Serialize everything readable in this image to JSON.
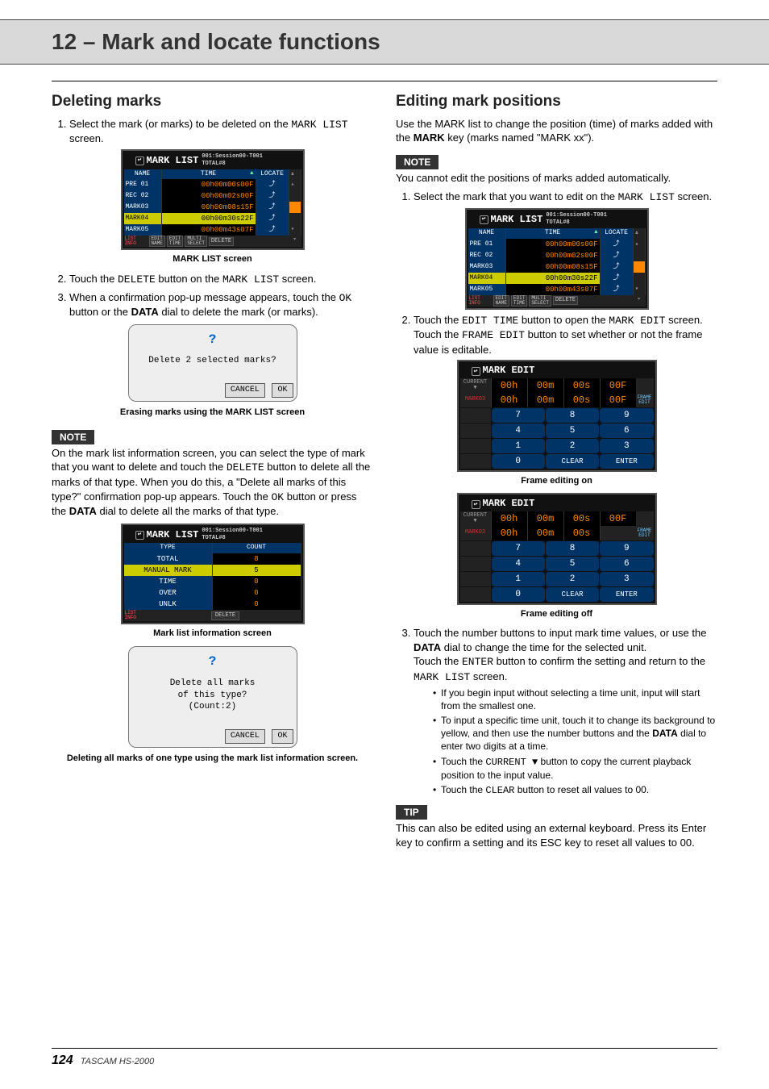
{
  "chapter": "12 – Mark and locate functions",
  "left": {
    "heading": "Deleting marks",
    "step1_a": "Select the mark (or marks) to be deleted on the ",
    "step1_b": "MARK LIST",
    "step1_c": " screen.",
    "mark_list_caption": "MARK LIST screen",
    "step2_a": "Touch the ",
    "step2_b": "DELETE",
    "step2_c": " button on the ",
    "step2_d": "MARK LIST",
    "step2_e": " screen.",
    "step3_a": "When a confirmation pop-up message appears, touch the ",
    "step3_b": "OK",
    "step3_c": " button or the ",
    "step3_d": "DATA",
    "step3_e": " dial to delete the mark (or marks).",
    "dialog1_msg": "Delete 2 selected marks?",
    "dialog_cancel": "CANCEL",
    "dialog_ok": "OK",
    "erasing_caption": "Erasing marks using the MARK LIST screen",
    "note_label": "NOTE",
    "note_a": "On the mark list information screen, you can select the type of mark that you want to delete and touch the ",
    "note_b": "DELETE",
    "note_c": " button to delete all the marks of that type. When you do this, a \"Delete all marks of this type?\" confirmation pop-up appears. Touch the ",
    "note_d": "OK",
    "note_e": " button or press the ",
    "note_f": "DATA",
    "note_g": " dial to delete all the marks of that type.",
    "info_caption": "Mark list information screen",
    "dialog2_line1": "Delete all marks",
    "dialog2_line2": "of this type?",
    "dialog2_line3": "(Count:2)",
    "deleting_caption": "Deleting all marks of one type using the mark list information screen."
  },
  "right": {
    "heading": "Editing mark positions",
    "intro_a": "Use the MARK list to change the position (time) of marks added with the ",
    "intro_b": "MARK",
    "intro_c": " key (marks named \"MARK xx\").",
    "note_label": "NOTE",
    "note_text": "You cannot edit the positions of marks added automatically.",
    "step1_a": "Select the mark that you want to edit on the ",
    "step1_b": "MARK LIST",
    "step1_c": " screen.",
    "step2_a": "Touch the ",
    "step2_b": "EDIT TIME",
    "step2_c": " button to open the ",
    "step2_d": "MARK EDIT",
    "step2_e": " screen. Touch the ",
    "step2_f": "FRAME EDIT",
    "step2_g": " button to set whether or not the frame value is editable.",
    "frame_on_caption": "Frame editing on",
    "frame_off_caption": "Frame editing off",
    "step3_a": "Touch the number buttons to input mark time values, or use the ",
    "step3_b": "DATA",
    "step3_c": " dial to change the time for the selected unit.",
    "step3_d": "Touch the ",
    "step3_e": "ENTER",
    "step3_f": " button to confirm the setting and return to the ",
    "step3_g": "MARK LIST",
    "step3_h": " screen.",
    "sub1": "If you begin input without selecting a time unit, input will start from the smallest one.",
    "sub2_a": "To input a specific time unit, touch it to change its background to yellow, and then use the number buttons and the ",
    "sub2_b": "DATA",
    "sub2_c": " dial to enter two digits at a time.",
    "sub3_a": "Touch the ",
    "sub3_b": "CURRENT ▼",
    "sub3_c": " button to copy the current playback position to the input value.",
    "sub4_a": "Touch the ",
    "sub4_b": "CLEAR",
    "sub4_c": " button to reset all values to 00.",
    "tip_label": "TIP",
    "tip_text": "This can also be edited using an external keyboard. Press its Enter key to confirm a setting and its ESC key to reset all values to 00."
  },
  "mark_list": {
    "title": "MARK LIST",
    "session": "001:Session00-T001",
    "total": "TOTAL#8",
    "hdr_name": "NAME",
    "hdr_time": "TIME",
    "hdr_locate": "LOCATE",
    "rows": [
      {
        "name": "PRE 01",
        "time": "00h00m00s00F",
        "sel": false
      },
      {
        "name": "REC 02",
        "time": "00h00m02s00F",
        "sel": false
      },
      {
        "name": "MARK03",
        "time": "00h00m08s15F",
        "sel": false
      },
      {
        "name": "MARK04",
        "time": "00h00m30s22F",
        "sel": true
      },
      {
        "name": "MARK05",
        "time": "00h00m43s07F",
        "sel": false
      }
    ],
    "bot_list": "LIST\nINFO",
    "bot_editname": "EDIT\nNAME",
    "bot_edittime": "EDIT\nTIME",
    "bot_multi": "MULTI\nSELECT",
    "bot_delete": "DELETE"
  },
  "info": {
    "hdr_type": "TYPE",
    "hdr_count": "COUNT",
    "rows": [
      {
        "t": "TOTAL",
        "c": "8",
        "sel": false
      },
      {
        "t": "MANUAL MARK",
        "c": "5",
        "sel": true
      },
      {
        "t": "TIME",
        "c": "0",
        "sel": false
      },
      {
        "t": "OVER",
        "c": "0",
        "sel": false
      },
      {
        "t": "UNLK",
        "c": "0",
        "sel": false
      }
    ],
    "bot_list": "LIST\nINFO",
    "bot_delete": "DELETE"
  },
  "edit": {
    "title": "MARK EDIT",
    "current": "CURRENT",
    "mark_label": "MARK03",
    "cur_vals": [
      "00h",
      "00m",
      "00s",
      "00F"
    ],
    "mark_vals": [
      "00h",
      "00m",
      "00s",
      "00F"
    ],
    "mark_vals_off": [
      "00h",
      "00m",
      "00s"
    ],
    "frame_edit": "FRAME\nEDIT",
    "keys": [
      "7",
      "8",
      "9",
      "4",
      "5",
      "6",
      "1",
      "2",
      "3",
      "0",
      "CLEAR",
      "ENTER"
    ]
  },
  "footer": {
    "page": "124",
    "model": "TASCAM  HS-2000"
  }
}
